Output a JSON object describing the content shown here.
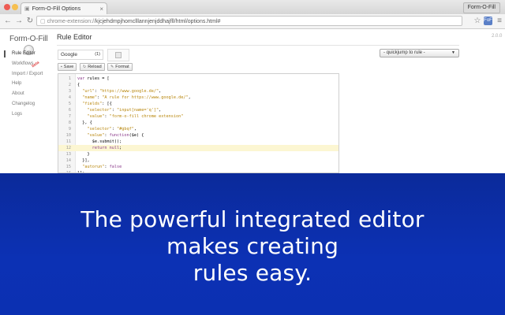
{
  "browser": {
    "tab_title": "Form-O-Fill Options",
    "url_scheme": "chrome-extension://",
    "url_rest": "kjcjehdmpjhomclllannjenjddhajfll/html/options.html#",
    "profile_name": "Form-O-Fill",
    "ext_icon_label": "FoF"
  },
  "sidebar": {
    "logo_text": "Form-O-Fill",
    "items": [
      {
        "label": "Rule Editor",
        "active": true
      },
      {
        "label": "Workflows",
        "active": false
      },
      {
        "label": "Import / Export",
        "active": false
      },
      {
        "label": "Help",
        "active": false
      },
      {
        "label": "About",
        "active": false
      },
      {
        "label": "Changelog",
        "active": false
      },
      {
        "label": "Logs",
        "active": false
      }
    ],
    "beta_badge": "beta"
  },
  "main": {
    "title": "Rule Editor",
    "version": "2.0.0",
    "rule_select": {
      "value": "Google",
      "count": "(1)"
    },
    "quickjump": {
      "label": "- quickjump to rule -"
    },
    "buttons": {
      "save": "Save",
      "reload": "Reload",
      "format": "Format"
    }
  },
  "editor": {
    "lines": [
      {
        "n": "1",
        "code": "var rules = ["
      },
      {
        "n": "2",
        "code": "{"
      },
      {
        "n": "3",
        "code": "  \"url\": \"https://www.google.de/\","
      },
      {
        "n": "4",
        "code": "  \"name\": \"A rule for https://www.google.de/\","
      },
      {
        "n": "5",
        "code": "  \"fields\": [{"
      },
      {
        "n": "6",
        "code": "    \"selector\": \"input[name='q']\","
      },
      {
        "n": "7",
        "code": "    \"value\": \"form-o-fill chrome extension\""
      },
      {
        "n": "8",
        "code": "  }, {"
      },
      {
        "n": "9",
        "code": "    \"selector\": \"#gbqf\","
      },
      {
        "n": "10",
        "code": "    \"value\": function($e) {"
      },
      {
        "n": "11",
        "code": "      $e.submit();"
      },
      {
        "n": "12",
        "code": "      return null;"
      },
      {
        "n": "13",
        "code": "    }"
      },
      {
        "n": "14",
        "code": "  }],"
      },
      {
        "n": "15",
        "code": "  \"autorun\": false"
      },
      {
        "n": "16",
        "code": "}];"
      }
    ],
    "highlighted_line": 12
  },
  "banner": {
    "line1": "The powerful integrated editor",
    "line2": "makes creating",
    "line3": "rules easy."
  },
  "colors": {
    "banner_bg": "#0c31b4",
    "highlight_line": "#fcf6d2"
  }
}
